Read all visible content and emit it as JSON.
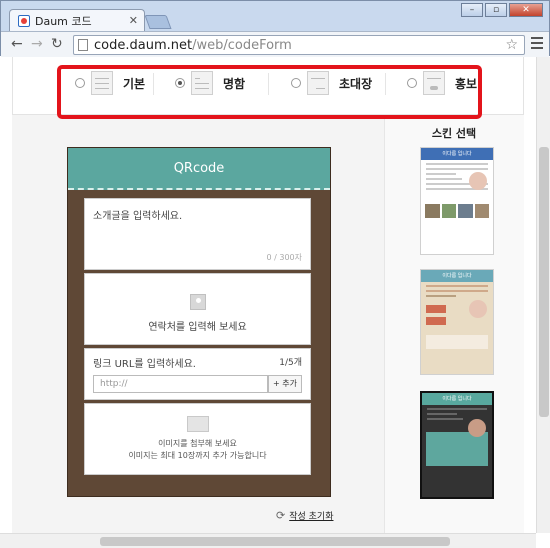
{
  "browser": {
    "tab_title": "Daum 코드",
    "tab_close": "✕",
    "url_host": "code.daum.net",
    "url_path": "/web/codeForm",
    "window_buttons": [
      "–",
      "▫",
      "✕"
    ]
  },
  "type_options": [
    {
      "label": "기본",
      "selected": false
    },
    {
      "label": "명함",
      "selected": true
    },
    {
      "label": "초대장",
      "selected": false
    },
    {
      "label": "홍보",
      "selected": false
    }
  ],
  "card": {
    "title": "QRcode",
    "intro_placeholder": "소개글을 입력하세요.",
    "intro_counter": "0 / 300자",
    "contact_prompt": "연락처를 입력해 보세요",
    "link_label": "링크 URL를 입력하세요.",
    "link_count": "1/5개",
    "link_placeholder": "http://",
    "add_button": "+ 추가",
    "image_prompt": "이미지를 첨부해 보세요",
    "image_limit": "이미지는 최대 10장까지 추가 가능합니다"
  },
  "reset_label": "작성 초기화",
  "skins": {
    "title": "스킨 선택",
    "names": [
      "이다름 입니다",
      "이다름 입니다",
      "이다름 입니다"
    ]
  },
  "colors": {
    "highlight": "#e3141b",
    "card_header": "#5ba79f",
    "card_body": "#5f4836"
  }
}
